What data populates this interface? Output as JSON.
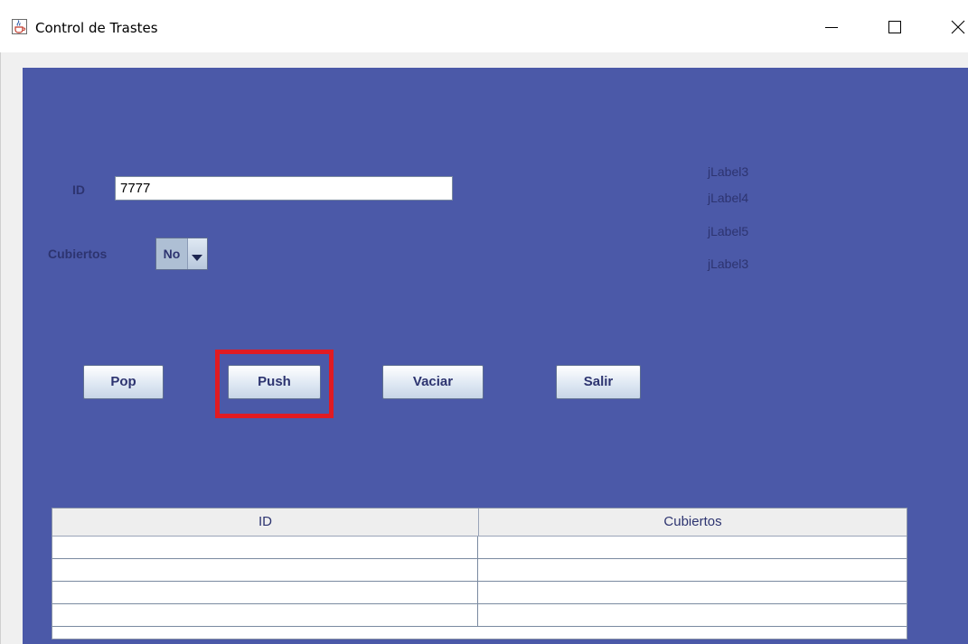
{
  "window": {
    "title": "Control de Trastes",
    "icon": "java-cup-icon",
    "controls": [
      "minimize-icon",
      "maximize-icon",
      "close-icon"
    ]
  },
  "form": {
    "id_label": "ID",
    "id_value": "7777",
    "cubiertos_label": "Cubiertos",
    "cubiertos_selected": "No"
  },
  "labels": {
    "label_1": "jLabel3",
    "label_2": "jLabel4",
    "label_3": "jLabel5",
    "label_4": "jLabel3"
  },
  "buttons": {
    "pop": "Pop",
    "push": "Push",
    "vaciar": "Vaciar",
    "salir": "Salir"
  },
  "table": {
    "columns": [
      "ID",
      "Cubiertos"
    ],
    "rows": [
      [
        "",
        ""
      ],
      [
        "",
        ""
      ],
      [
        "",
        ""
      ],
      [
        "",
        ""
      ]
    ]
  },
  "colors": {
    "panel_background": "#4b59a8",
    "label_text": "#2d3470",
    "highlight": "#e11b22"
  }
}
